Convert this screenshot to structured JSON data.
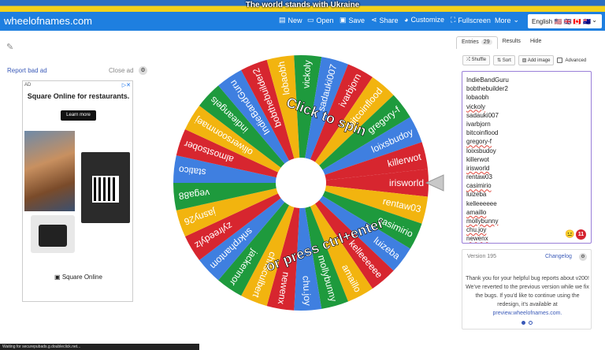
{
  "banner": {
    "text": "The world stands with Ukraine"
  },
  "nav": {
    "logo": "wheelofnames.com",
    "items": [
      {
        "label": "New",
        "icon": "file-icon"
      },
      {
        "label": "Open",
        "icon": "folder-icon"
      },
      {
        "label": "Save",
        "icon": "save-icon"
      },
      {
        "label": "Share",
        "icon": "share-icon"
      },
      {
        "label": "Customize",
        "icon": "palette-icon"
      },
      {
        "label": "Fullscreen",
        "icon": "fullscreen-icon"
      },
      {
        "label": "More",
        "icon": "chevron-down-icon"
      }
    ],
    "language": "English 🇺🇸 🇬🇧 🇨🇦 🇦🇺"
  },
  "ad": {
    "report": "Report bad ad",
    "close": "Close ad",
    "badge": "AD",
    "headline": "Square Online for restaurants.",
    "button": "Learn more",
    "footer": "Square Online"
  },
  "wheel": {
    "overlay_top": "Click to spin",
    "overlay_bottom": "or press ctrl+enter",
    "colors": [
      "#d7262f",
      "#f2b40f",
      "#1e9a3d",
      "#3f7fe0"
    ]
  },
  "sidebar": {
    "tabs": [
      {
        "label": "Entries",
        "count": "29"
      },
      {
        "label": "Results"
      },
      {
        "label": "Hide"
      }
    ],
    "tools": {
      "shuffle": "Shuffle",
      "sort": "Sort",
      "add_image": "Add image",
      "advanced": "Advanced"
    },
    "entries": [
      "IndieBandGuru",
      "bobthebuilder2",
      "lobaobh",
      "vickoly",
      "sadauki007",
      "ivarbjorn",
      "bitcoinflood",
      "gregory-f",
      "loixsbudoy",
      "killerwot",
      "irisworld",
      "rentaw03",
      "casimirio",
      "luizeba",
      "kelleeeeee",
      "amaillo",
      "mollybunny",
      "chu.joy",
      "newenx"
    ],
    "squiggly": [
      "vickoly",
      "gregory-f",
      "irisworld",
      "casimirio",
      "amaillo",
      "mollybunny",
      "chu.joy",
      "newenx"
    ],
    "error_count": "11",
    "version": "Version 195",
    "changelog": "Changelog",
    "notice": "Thank you for your helpful bug reports about v200! We've reverted to the previous version while we fix the bugs. If you'd like to continue using the redesign, it's available at",
    "notice_link": "preview.wheelofnames.com."
  },
  "status_bar": "Waiting for securepubads.g.doubleclick.net..."
}
